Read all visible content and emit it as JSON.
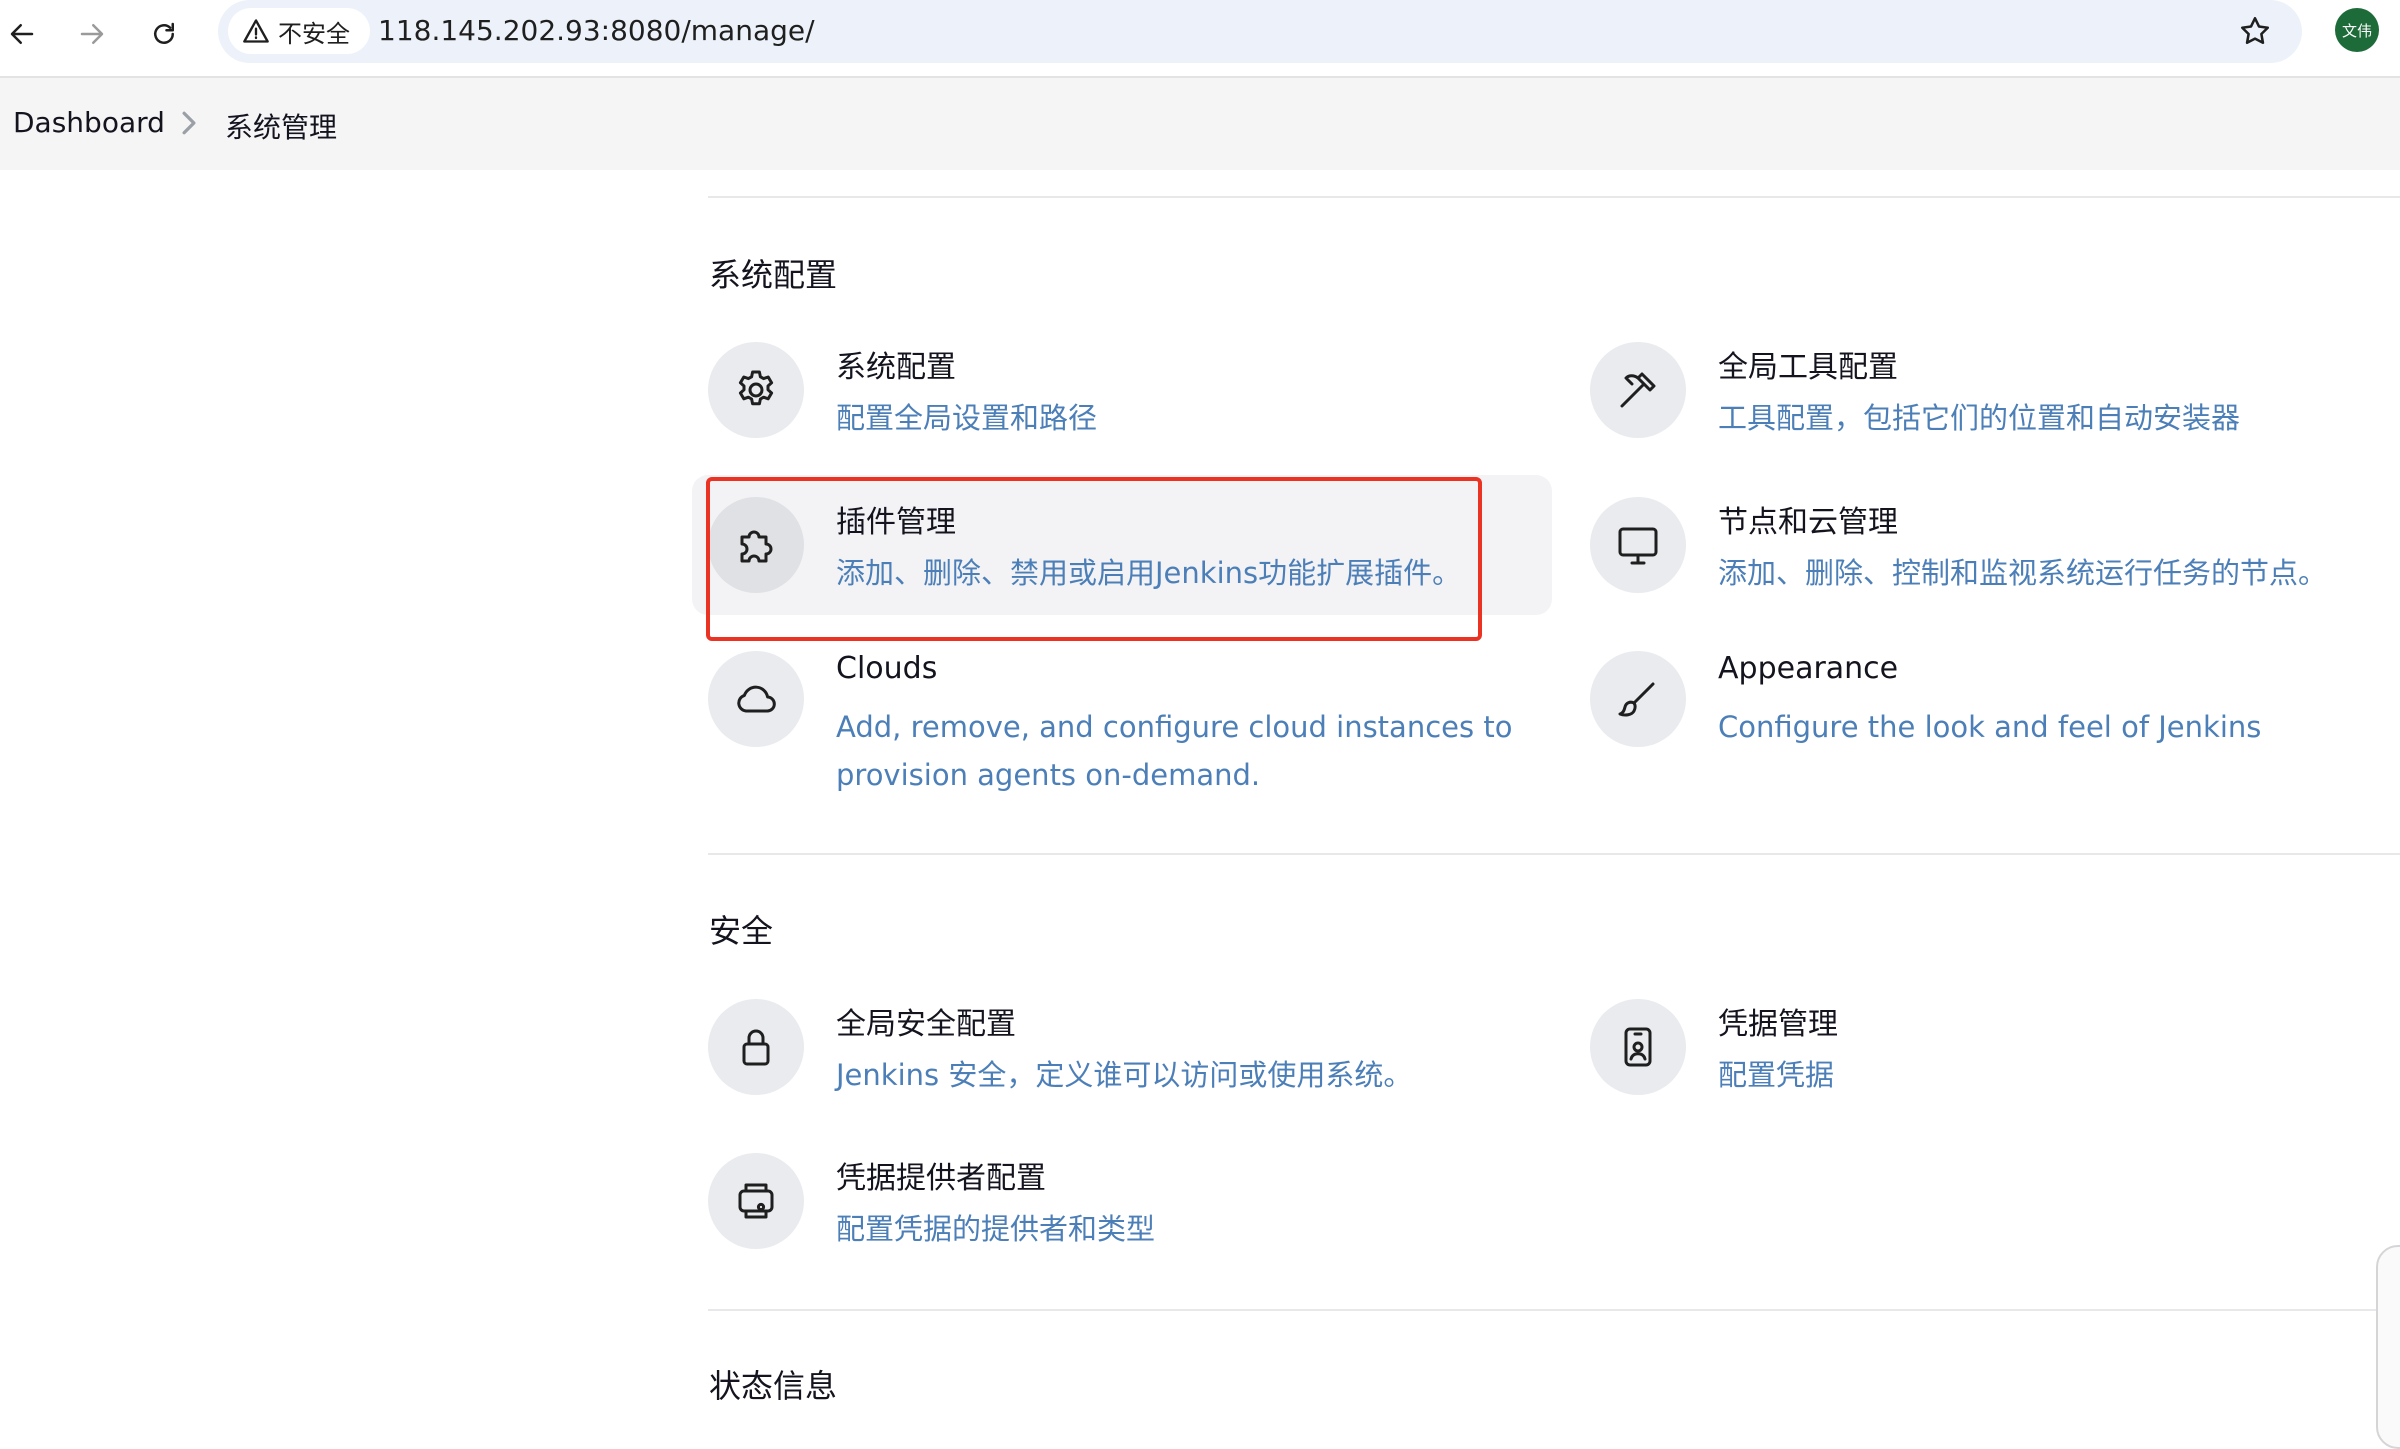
{
  "browser": {
    "security_label": "不安全",
    "url": "118.145.202.93:8080/manage/",
    "profile_initials": "文伟"
  },
  "breadcrumb": {
    "home": "Dashboard",
    "current": "系统管理"
  },
  "sections": {
    "system_config": {
      "title": "系统配置",
      "items": [
        {
          "title": "系统配置",
          "desc": "配置全局设置和路径",
          "icon": "gear-icon"
        },
        {
          "title": "全局工具配置",
          "desc": "工具配置，包括它们的位置和自动安装器",
          "icon": "hammer-icon"
        },
        {
          "title": "插件管理",
          "desc": "添加、删除、禁用或启用Jenkins功能扩展插件。",
          "icon": "puzzle-icon"
        },
        {
          "title": "节点和云管理",
          "desc": "添加、删除、控制和监视系统运行任务的节点。",
          "icon": "monitor-icon"
        },
        {
          "title": "Clouds",
          "desc": "Add, remove, and configure cloud instances to provision agents on-demand.",
          "icon": "cloud-icon"
        },
        {
          "title": "Appearance",
          "desc": "Configure the look and feel of Jenkins",
          "icon": "brush-icon"
        }
      ]
    },
    "security": {
      "title": "安全",
      "items": [
        {
          "title": "全局安全配置",
          "desc": "Jenkins 安全，定义谁可以访问或使用系统。",
          "icon": "lock-icon"
        },
        {
          "title": "凭据管理",
          "desc": "配置凭据",
          "icon": "id-card-icon"
        },
        {
          "title": "凭据提供者配置",
          "desc": "配置凭据的提供者和类型",
          "icon": "credential-provider-icon"
        }
      ]
    },
    "status": {
      "title": "状态信息"
    }
  },
  "colors": {
    "link_blue": "#4c7fb8",
    "highlight_red": "#ea3323",
    "icon_bg": "#e9ebef"
  }
}
